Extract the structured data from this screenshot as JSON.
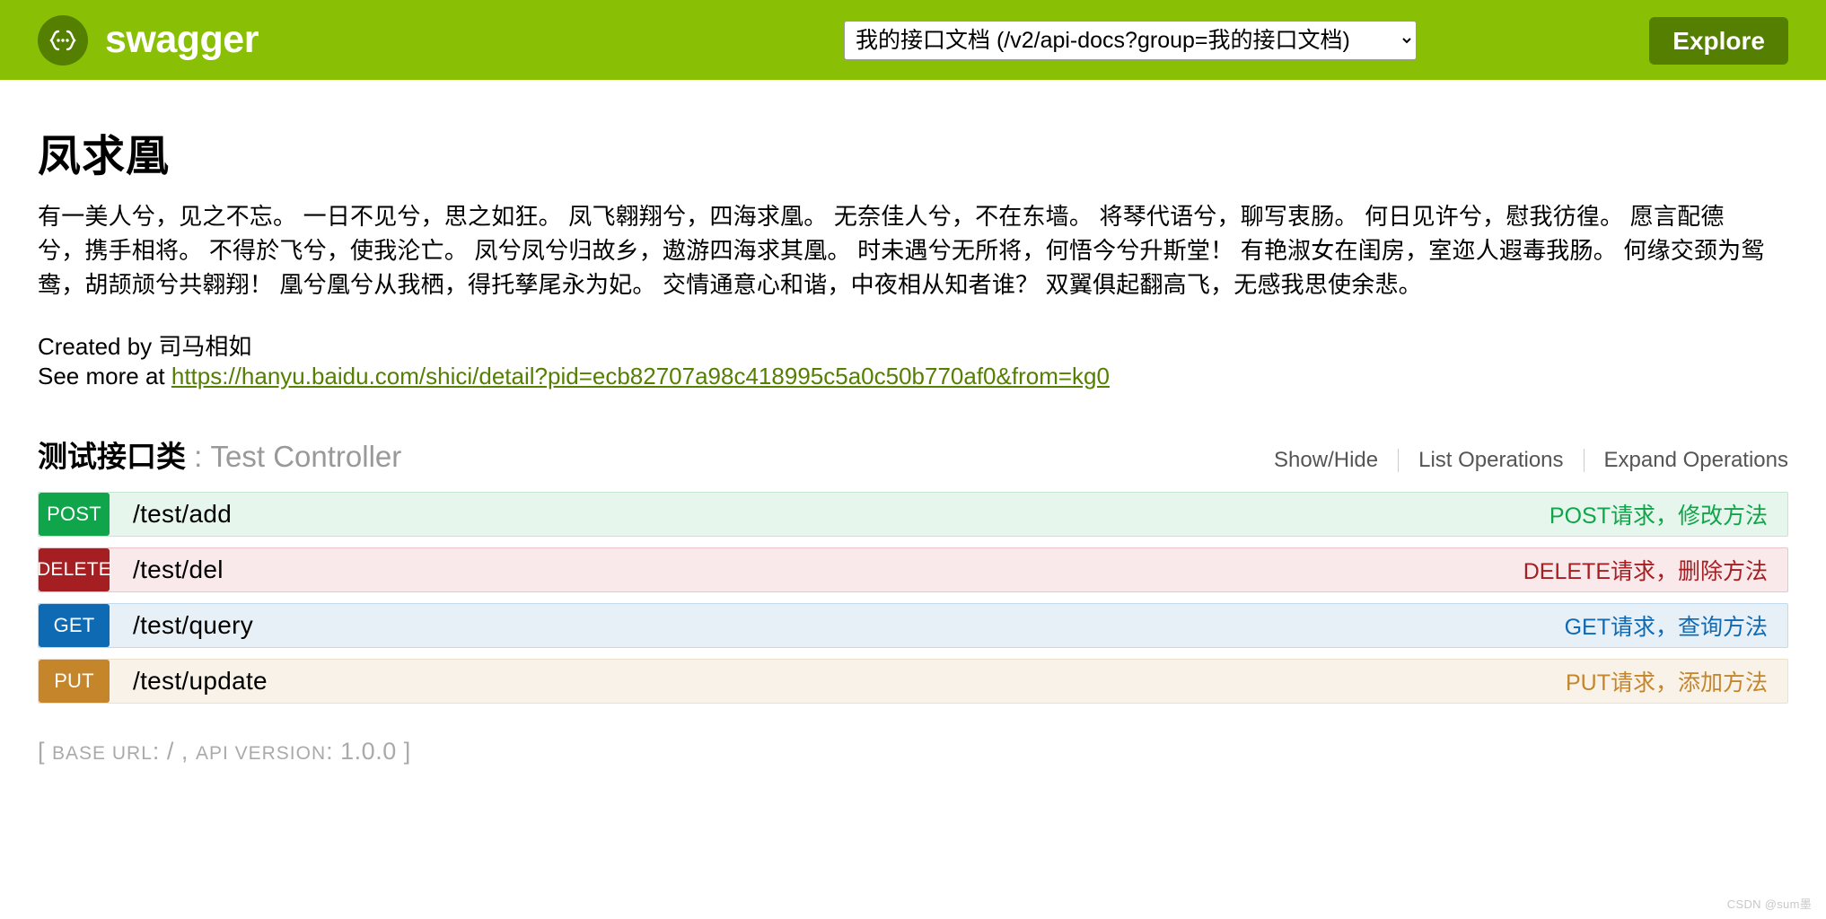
{
  "topbar": {
    "logo_text": "swagger",
    "logo_icon": "swagger-braces-icon",
    "explore_label": "Explore",
    "select_value": "我的接口文档 (/v2/api-docs?group=我的接口文档)",
    "select_options": [
      "我的接口文档 (/v2/api-docs?group=我的接口文档)"
    ],
    "bar_color": "#89bf04",
    "accent_dark": "#547f00"
  },
  "info": {
    "title": "凤求凰",
    "description": "有一美人兮，见之不忘。 一日不见兮，思之如狂。 凤飞翱翔兮，四海求凰。 无奈佳人兮，不在东墙。 将琴代语兮，聊写衷肠。 何日见许兮，慰我彷徨。 愿言配德兮，携手相将。 不得於飞兮，使我沦亡。 凤兮凤兮归故乡，遨游四海求其凰。 时未遇兮无所将，何悟今兮升斯堂！ 有艳淑女在闺房，室迩人遐毒我肠。 何缘交颈为鸳鸯，胡颉颃兮共翱翔！ 凰兮凰兮从我栖，得托孳尾永为妃。 交情通意心和谐，中夜相从知者谁？ 双翼俱起翻高飞，无感我思使余悲。",
    "created_by_label": "Created by 司马相如",
    "see_more_label": "See more at ",
    "see_more_url": "https://hanyu.baidu.com/shici/detail?pid=ecb82707a98c418995c5a0c50b770af0&from=kg0"
  },
  "resource": {
    "name": "测试接口类",
    "separator": " : ",
    "class_name": "Test Controller",
    "actions": [
      {
        "label": "Show/Hide"
      },
      {
        "label": "List Operations"
      },
      {
        "label": "Expand Operations"
      }
    ]
  },
  "operations": [
    {
      "method": "POST",
      "path": "/test/add",
      "summary": "POST请求，修改方法",
      "color": "#10a54a"
    },
    {
      "method": "DELETE",
      "path": "/test/del",
      "summary": "DELETE请求，删除方法",
      "color": "#a41e22"
    },
    {
      "method": "GET",
      "path": "/test/query",
      "summary": "GET请求，查询方法",
      "color": "#0f6ab4"
    },
    {
      "method": "PUT",
      "path": "/test/update",
      "summary": "PUT请求，添加方法",
      "color": "#c5862b"
    }
  ],
  "footer": {
    "open_bracket": "[ ",
    "base_url_label": "BASE URL",
    "base_url_sep": ": ",
    "base_url_value": "/",
    "comma": " , ",
    "api_version_label": "API VERSION",
    "api_version_sep": ": ",
    "api_version_value": "1.0.0",
    "close_bracket": " ]"
  },
  "watermark": "CSDN @sum墨"
}
